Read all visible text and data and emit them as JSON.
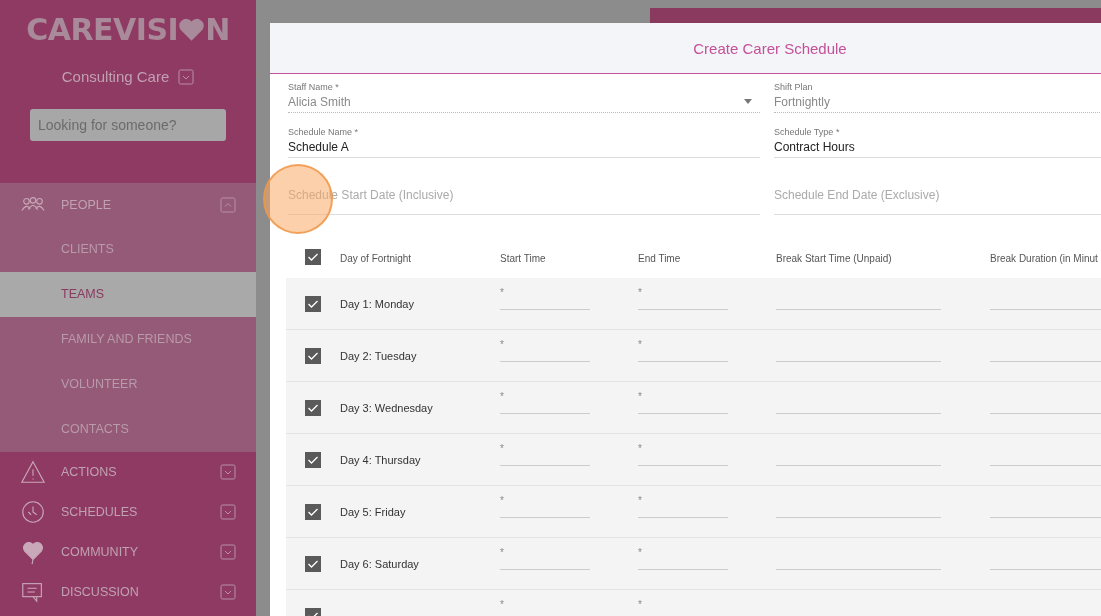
{
  "sidebar": {
    "logo_parts": [
      "CAREVISI",
      "N"
    ],
    "organization": "Consulting Care",
    "search": {
      "placeholder": "Looking for someone?"
    },
    "nav": [
      {
        "label": "PEOPLE",
        "expanded": true,
        "children": [
          {
            "label": "CLIENTS",
            "selected": false
          },
          {
            "label": "TEAMS",
            "selected": true
          },
          {
            "label": "FAMILY AND FRIENDS",
            "selected": false
          },
          {
            "label": "VOLUNTEER",
            "selected": false
          },
          {
            "label": "CONTACTS",
            "selected": false
          }
        ]
      },
      {
        "label": "ACTIONS",
        "expanded": false
      },
      {
        "label": "SCHEDULES",
        "expanded": false
      },
      {
        "label": "COMMUNITY",
        "expanded": false
      },
      {
        "label": "DISCUSSION",
        "expanded": false
      }
    ]
  },
  "dialog": {
    "title": "Create Carer Schedule",
    "fields": [
      {
        "kind": "select",
        "label": "Staff Name *",
        "value": "Alicia Smith",
        "disabled": true
      },
      {
        "kind": "readonly",
        "label": "Shift Plan",
        "value": "Fortnightly",
        "disabled": true
      },
      {
        "kind": "text",
        "label": "Schedule Name *",
        "value": "Schedule A"
      },
      {
        "kind": "text",
        "label": "Schedule Type *",
        "value": "Contract Hours"
      },
      {
        "kind": "date",
        "placeholder": "Schedule Start Date (Inclusive)"
      },
      {
        "kind": "date",
        "placeholder": "Schedule End Date (Exclusive)"
      }
    ],
    "table": {
      "all_checked": true,
      "columns": [
        "Day of Fortnight",
        "Start Time",
        "End Time",
        "Break Start Time (Unpaid)",
        "Break Duration (in Minut"
      ],
      "rows": [
        {
          "checked": true,
          "day": "Day 1: Monday",
          "start": "*",
          "end": "*"
        },
        {
          "checked": true,
          "day": "Day 2: Tuesday",
          "start": "*",
          "end": "*"
        },
        {
          "checked": true,
          "day": "Day 3: Wednesday",
          "start": "*",
          "end": "*"
        },
        {
          "checked": true,
          "day": "Day 4: Thursday",
          "start": "*",
          "end": "*"
        },
        {
          "checked": true,
          "day": "Day 5: Friday",
          "start": "*",
          "end": "*"
        },
        {
          "checked": true,
          "day": "Day 6: Saturday",
          "start": "*",
          "end": "*"
        },
        {
          "checked": true,
          "start": "*",
          "end": "*"
        }
      ]
    }
  }
}
